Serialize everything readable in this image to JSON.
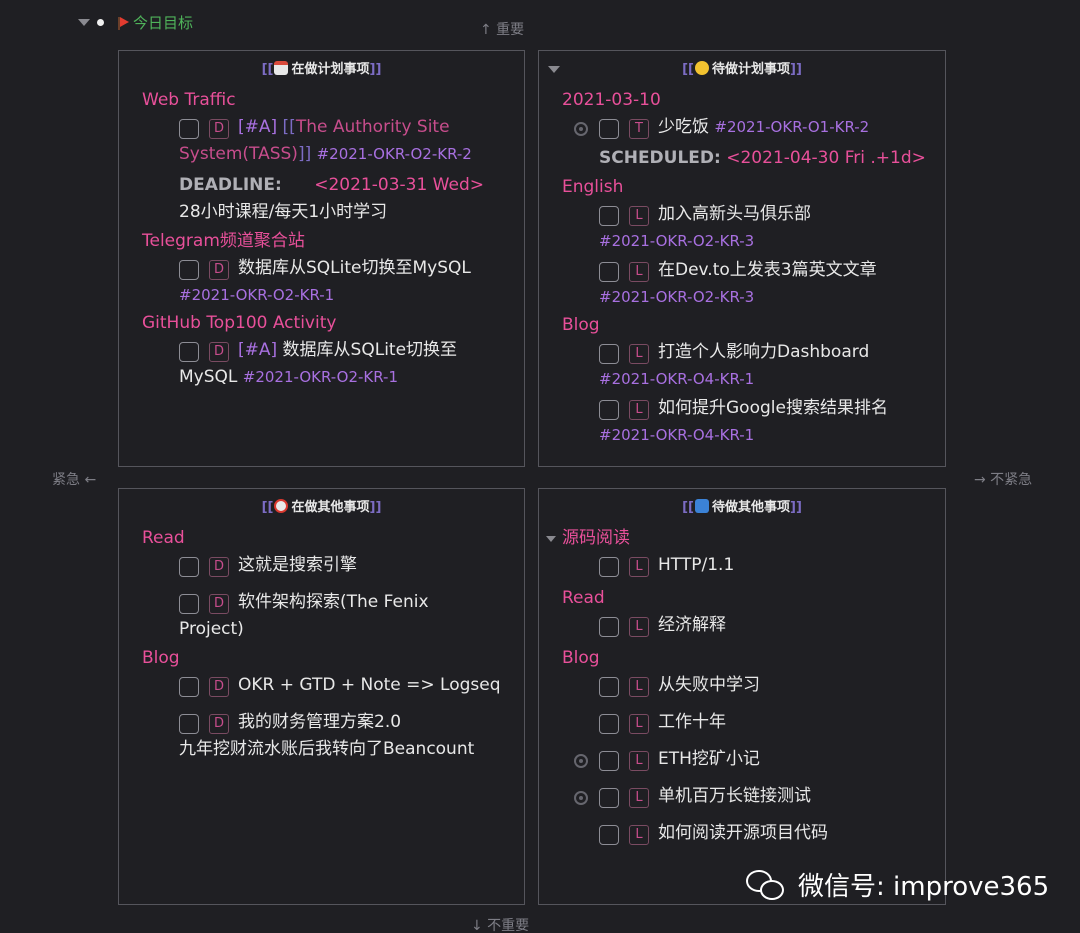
{
  "block": {
    "title": "今日目标"
  },
  "axes": {
    "top": "↑ 重要",
    "bottom": "↓ 不重要",
    "left": "紧急 ←",
    "right": "→ 不紧急"
  },
  "q1": {
    "bracket_open": "[[",
    "bracket_close": "]]",
    "title": "在做计划事项",
    "groups": [
      {
        "name": "Web Traffic"
      },
      {
        "name": "Telegram频道聚合站"
      },
      {
        "name": "GitHub Top100 Activity"
      }
    ],
    "tasks": [
      {
        "marker": "D",
        "priority": "[#A]",
        "ref_open": "[[",
        "ref_text_1": "The Authority Site",
        "ref_text_2": "System(TASS)",
        "ref_close": "]]",
        "tag": "#2021-OKR-O2-KR-2",
        "deadline_label": "DEADLINE:",
        "deadline_value": "<2021-03-31 Wed>",
        "note": "28小时课程/每天1小时学习"
      },
      {
        "marker": "D",
        "text": "数据库从SQLite切换至MySQL",
        "tag": "#2021-OKR-O2-KR-1"
      },
      {
        "marker": "D",
        "priority": "[#A]",
        "text_1": "数据库从SQLite切换至",
        "text_2": "MySQL",
        "tag": "#2021-OKR-O2-KR-1"
      }
    ]
  },
  "q2": {
    "bracket_open": "[[",
    "bracket_close": "]]",
    "title": "待做计划事项",
    "groups": [
      {
        "name": "2021-03-10"
      },
      {
        "name": "English"
      },
      {
        "name": "Blog"
      }
    ],
    "tasks": [
      {
        "marker": "T",
        "text": "少吃饭",
        "tag": "#2021-OKR-O1-KR-2",
        "scheduled_label": "SCHEDULED:",
        "scheduled_value": "<2021-04-30 Fri .+1d>"
      },
      {
        "marker": "L",
        "text": "加入高新头马俱乐部",
        "tag": "#2021-OKR-O2-KR-3"
      },
      {
        "marker": "L",
        "text": "在Dev.to上发表3篇英文文章",
        "tag": "#2021-OKR-O2-KR-3"
      },
      {
        "marker": "L",
        "text": "打造个人影响力Dashboard",
        "tag": "#2021-OKR-O4-KR-1"
      },
      {
        "marker": "L",
        "text": "如何提升Google搜索结果排名",
        "tag": "#2021-OKR-O4-KR-1"
      }
    ]
  },
  "q3": {
    "bracket_open": "[[",
    "bracket_close": "]]",
    "title": "在做其他事项",
    "groups": [
      {
        "name": "Read"
      },
      {
        "name": "Blog"
      }
    ],
    "tasks": [
      {
        "marker": "D",
        "text": "这就是搜索引擎"
      },
      {
        "marker": "D",
        "text_1": "软件架构探索(The Fenix",
        "text_2": "Project)"
      },
      {
        "marker": "D",
        "text": "OKR + GTD + Note => Logseq"
      },
      {
        "marker": "D",
        "text_1": "我的财务管理方案2.0",
        "text_2": "九年挖财流水账后我转向了Beancount"
      }
    ]
  },
  "q4": {
    "bracket_open": "[[",
    "bracket_close": "]]",
    "title": "待做其他事项",
    "groups": [
      {
        "name": "源码阅读"
      },
      {
        "name": "Read"
      },
      {
        "name": "Blog"
      }
    ],
    "tasks": [
      {
        "marker": "L",
        "text": "HTTP/1.1"
      },
      {
        "marker": "L",
        "text": "经济解释"
      },
      {
        "marker": "L",
        "text": "从失败中学习"
      },
      {
        "marker": "L",
        "text": "工作十年"
      },
      {
        "marker": "L",
        "text": "ETH挖矿小记"
      },
      {
        "marker": "L",
        "text": "单机百万长链接测试"
      },
      {
        "marker": "L",
        "text": "如何阅读开源项目代码"
      }
    ]
  },
  "watermark": {
    "text": "微信号: improve365"
  }
}
